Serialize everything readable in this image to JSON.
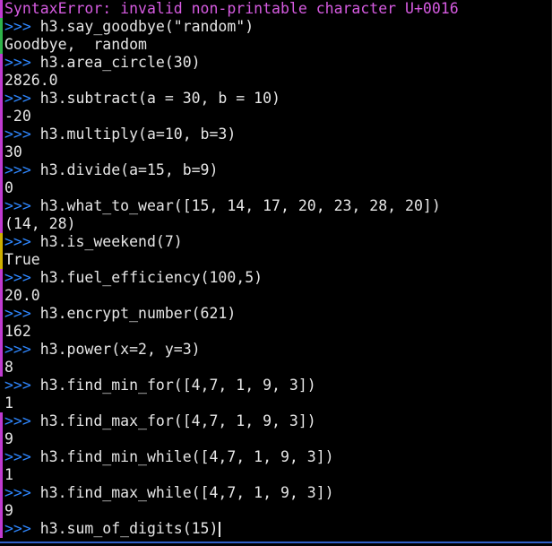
{
  "colors": {
    "background": "#000000",
    "text": "#e6e6e6",
    "prompt": "#2f87ff",
    "error": "#d65be1",
    "gutter_green": "#2fb34a",
    "gutter_purple": "#c03ad0",
    "gutter_yellow": "#d0b000"
  },
  "prompt": ">>>",
  "lines": [
    {
      "type": "error",
      "name": "SyntaxError:",
      "msg": " invalid non-printable character U+0016",
      "gutter": "purple"
    },
    {
      "type": "input",
      "code": "h3.say_goodbye(\"random\")",
      "gutter": "green"
    },
    {
      "type": "output",
      "text": "Goodbye,  random",
      "gutter": "green"
    },
    {
      "type": "input",
      "code": "h3.area_circle(30)",
      "gutter": "purple"
    },
    {
      "type": "output",
      "text": "2826.0",
      "gutter": "purple"
    },
    {
      "type": "input",
      "code": "h3.subtract(a = 30, b = 10)",
      "gutter": "purple"
    },
    {
      "type": "output",
      "text": "-20",
      "gutter": "purple"
    },
    {
      "type": "input",
      "code": "h3.multiply(a=10, b=3)",
      "gutter": "purple"
    },
    {
      "type": "output",
      "text": "30",
      "gutter": "purple"
    },
    {
      "type": "input",
      "code": "h3.divide(a=15, b=9)",
      "gutter": "purple"
    },
    {
      "type": "output",
      "text": "0",
      "gutter": "purple"
    },
    {
      "type": "input",
      "code": "h3.what_to_wear([15, 14, 17, 20, 23, 28, 20])",
      "gutter": "purple"
    },
    {
      "type": "output",
      "text": "(14, 28)",
      "gutter": "purple"
    },
    {
      "type": "input",
      "code": "h3.is_weekend(7)",
      "gutter": "yellow"
    },
    {
      "type": "output",
      "text": "True",
      "gutter": "yellow"
    },
    {
      "type": "input",
      "code": "h3.fuel_efficiency(100,5)",
      "gutter": "purple"
    },
    {
      "type": "output",
      "text": "20.0",
      "gutter": "purple"
    },
    {
      "type": "input",
      "code": "h3.encrypt_number(621)",
      "gutter": "purple"
    },
    {
      "type": "output",
      "text": "162",
      "gutter": "purple"
    },
    {
      "type": "input",
      "code": "h3.power(x=2, y=3)",
      "gutter": "purple"
    },
    {
      "type": "output",
      "text": "8",
      "gutter": "purple"
    },
    {
      "type": "input",
      "code": "h3.find_min_for([4,7, 1, 9, 3])",
      "gutter": "none"
    },
    {
      "type": "output",
      "text": "1",
      "gutter": "none"
    },
    {
      "type": "input",
      "code": "h3.find_max_for([4,7, 1, 9, 3])",
      "gutter": "purple"
    },
    {
      "type": "output",
      "text": "9",
      "gutter": "purple"
    },
    {
      "type": "input",
      "code": "h3.find_min_while([4,7, 1, 9, 3])",
      "gutter": "purple"
    },
    {
      "type": "output",
      "text": "1",
      "gutter": "purple"
    },
    {
      "type": "input",
      "code": "h3.find_max_while([4,7, 1, 9, 3])",
      "gutter": "purple"
    },
    {
      "type": "output",
      "text": "9",
      "gutter": "purple"
    },
    {
      "type": "current",
      "code": "h3.sum_of_digits(15)",
      "gutter": "purple"
    }
  ]
}
